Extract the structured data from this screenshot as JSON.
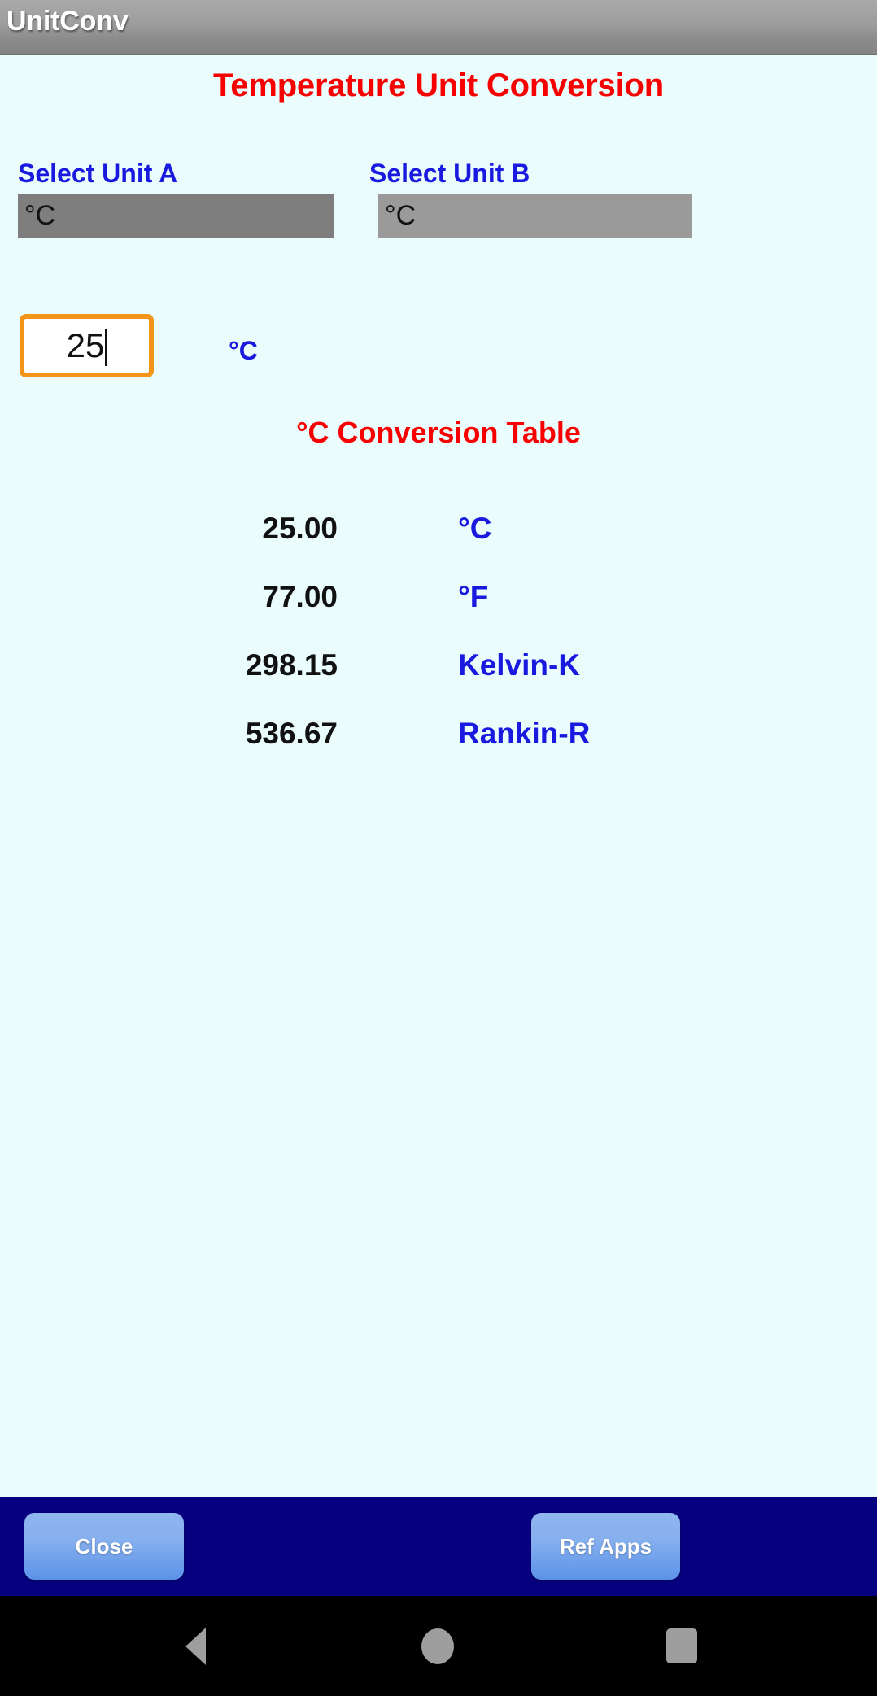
{
  "app": {
    "name": "UnitConv"
  },
  "screen": {
    "title": "Temperature Unit Conversion",
    "background_color": "#eafcfc",
    "title_color": "#f80000",
    "accent_blue": "#1919e0",
    "input_border_color": "#f29418"
  },
  "selectors": {
    "unit_a": {
      "label": "Select Unit A",
      "selected": "°C"
    },
    "unit_b": {
      "label": "Select Unit B",
      "selected": "°C"
    }
  },
  "input": {
    "value": "25",
    "unit": "°C"
  },
  "table": {
    "title": "°C Conversion Table",
    "rows": [
      {
        "value": "25.00",
        "unit": "°C"
      },
      {
        "value": "77.00",
        "unit": "°F"
      },
      {
        "value": "298.15",
        "unit": "Kelvin-K"
      },
      {
        "value": "536.67",
        "unit": "Rankin-R"
      }
    ]
  },
  "buttons": {
    "close": "Close",
    "ref_apps": "Ref Apps",
    "bar_color": "#060080"
  },
  "navbar": {
    "back": "back-icon",
    "home": "home-icon",
    "recent": "recents-icon"
  }
}
